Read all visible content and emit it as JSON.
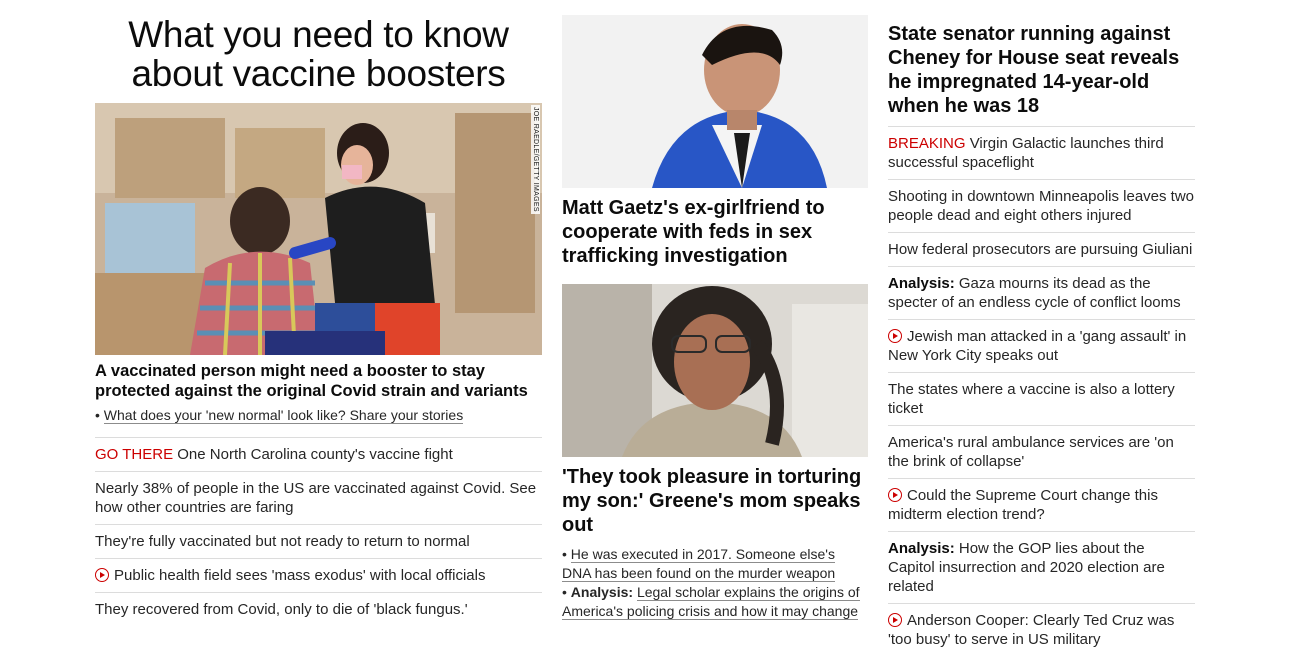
{
  "col1": {
    "title": "What you need to know about vaccine boosters",
    "photo_credit": "JOE RAEDLE/GETTY IMAGES",
    "headline": "A vaccinated person might need a booster to stay protected against the original Covid strain and variants",
    "bullet": "What does your 'new normal' look like? Share your stories",
    "items": [
      {
        "label": "GO THERE",
        "text": "One North Carolina county's vaccine fight"
      },
      {
        "text": "Nearly 38% of people in the US are vaccinated against Covid. See how other countries are faring"
      },
      {
        "text": "They're fully vaccinated but not ready to return to normal"
      },
      {
        "icon": "play-icon",
        "text": "Public health field sees 'mass exodus' with local officials"
      },
      {
        "text": "They recovered from Covid, only to die of 'black fungus.'"
      }
    ]
  },
  "col2": {
    "story1_headline": "Matt Gaetz's ex-girlfriend to cooperate with feds in sex trafficking investigation",
    "story2_headline": "'They took pleasure in torturing my son:' Greene's mom speaks out",
    "bullet1": "He was executed in 2017. Someone else's DNA has been found on the murder weapon",
    "bullet2_label": "Analysis:",
    "bullet2": "Legal scholar explains the origins of America's policing crisis and how it may change"
  },
  "col3": {
    "headline": "State senator running against Cheney for House seat reveals he impregnated 14-year-old when he was 18",
    "items": [
      {
        "label": "BREAKING",
        "text": "Virgin Galactic launches third successful spaceflight"
      },
      {
        "text": "Shooting in downtown Minneapolis leaves two people dead and eight others injured"
      },
      {
        "text": "How federal prosecutors are pursuing Giuliani"
      },
      {
        "bold": "Analysis:",
        "text": "Gaza mourns its dead as the specter of an endless cycle of conflict looms"
      },
      {
        "icon": "play-icon",
        "text": "Jewish man attacked in a 'gang assault' in New York City speaks out"
      },
      {
        "text": "The states where a vaccine is also a lottery ticket"
      },
      {
        "text": "America's rural ambulance services are 'on the brink of collapse'"
      },
      {
        "icon": "play-icon",
        "text": "Could the Supreme Court change this midterm election trend?"
      },
      {
        "bold": "Analysis:",
        "text": "How the GOP lies about the Capitol insurrection and 2020 election are related"
      },
      {
        "icon": "play-icon",
        "text": "Anderson Cooper: Clearly Ted Cruz was 'too busy' to serve in US military"
      }
    ]
  },
  "colors": {
    "accent_red": "#cc0000",
    "text": "#262626",
    "divider": "#dcdcdc"
  }
}
